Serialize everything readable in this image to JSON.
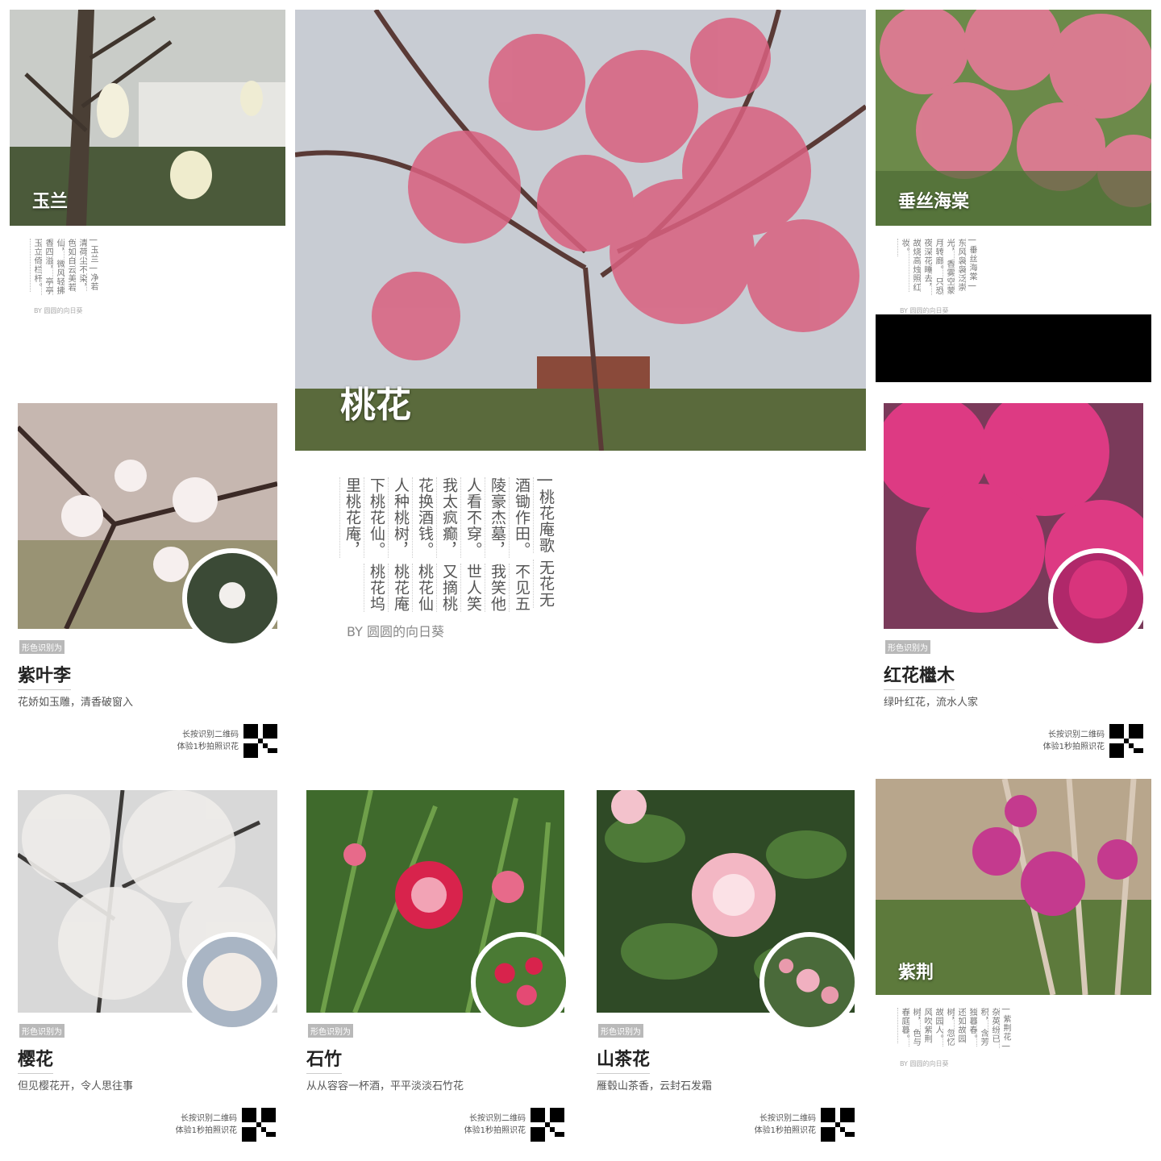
{
  "panels": {
    "yulan": {
      "title": "玉兰",
      "poem_cols": [
        "| 玉兰 |",
        "净若清荷尘不染，",
        "色如白云美若仙，",
        "微风轻拂香四溢，",
        "亭亭玉立倚栏杆。"
      ],
      "byline": "BY 圆圆的向日葵"
    },
    "taohua": {
      "title": "桃花",
      "poem_cols": [
        "| 桃花庵歌",
        "无花无酒锄作田。",
        "不见五陵豪杰墓，",
        "我笑他人看不穿。",
        "世人笑我太疯癫，",
        "又摘桃花换酒钱。",
        "桃花仙人种桃树，",
        "桃花庵下桃花仙。",
        "桃花坞里桃花庵，"
      ],
      "byline": "BY 圆圆的向日葵"
    },
    "haitang": {
      "title": "垂丝海棠",
      "poem_cols": [
        "| 垂丝海棠 |",
        "东风袅袅泛崇光，",
        "香雾空蒙月转廊。",
        "只恐夜深花睡去，",
        "故烧高烛照红妆。"
      ],
      "byline": "BY 圆圆的向日葵"
    },
    "ziyeli": {
      "tag": "形色识别为",
      "name": "紫叶李",
      "desc": "花娇如玉雕，清香破窗入",
      "qr_line1": "长按识别二维码",
      "qr_line2": "体验1秒拍照识花"
    },
    "hongjimu": {
      "tag": "形色识别为",
      "name": "红花檵木",
      "desc": "绿叶红花，流水人家",
      "qr_line1": "长按识别二维码",
      "qr_line2": "体验1秒拍照识花"
    },
    "yinghua": {
      "tag": "形色识别为",
      "name": "樱花",
      "desc": "但见樱花开，令人思往事",
      "qr_line1": "长按识别二维码",
      "qr_line2": "体验1秒拍照识花"
    },
    "shizhu": {
      "tag": "形色识别为",
      "name": "石竹",
      "desc": "从从容容一杯酒，平平淡淡石竹花",
      "qr_line1": "长按识别二维码",
      "qr_line2": "体验1秒拍照识花"
    },
    "shancha": {
      "tag": "形色识别为",
      "name": "山茶花",
      "desc": "雁毂山茶香，云封石发霜",
      "qr_line1": "长按识别二维码",
      "qr_line2": "体验1秒拍照识花"
    },
    "zijing": {
      "title": "紫荆",
      "poem_cols": [
        "| 紫荆花 |",
        "杂英纷已积，",
        "含芳独暮春。",
        "还如故园树，",
        "忽忆故园人。",
        "风吹紫荆树，",
        "色与春庭暮。"
      ],
      "byline": "BY 圆圆的向日葵"
    }
  },
  "colors": {
    "peach": "#d9607f",
    "haitang": "#e47a97",
    "loropetalum": "#e33a86",
    "redbud": "#c43a8e",
    "camellia": "#f3b7c4",
    "dianthus": "#d8234c"
  }
}
